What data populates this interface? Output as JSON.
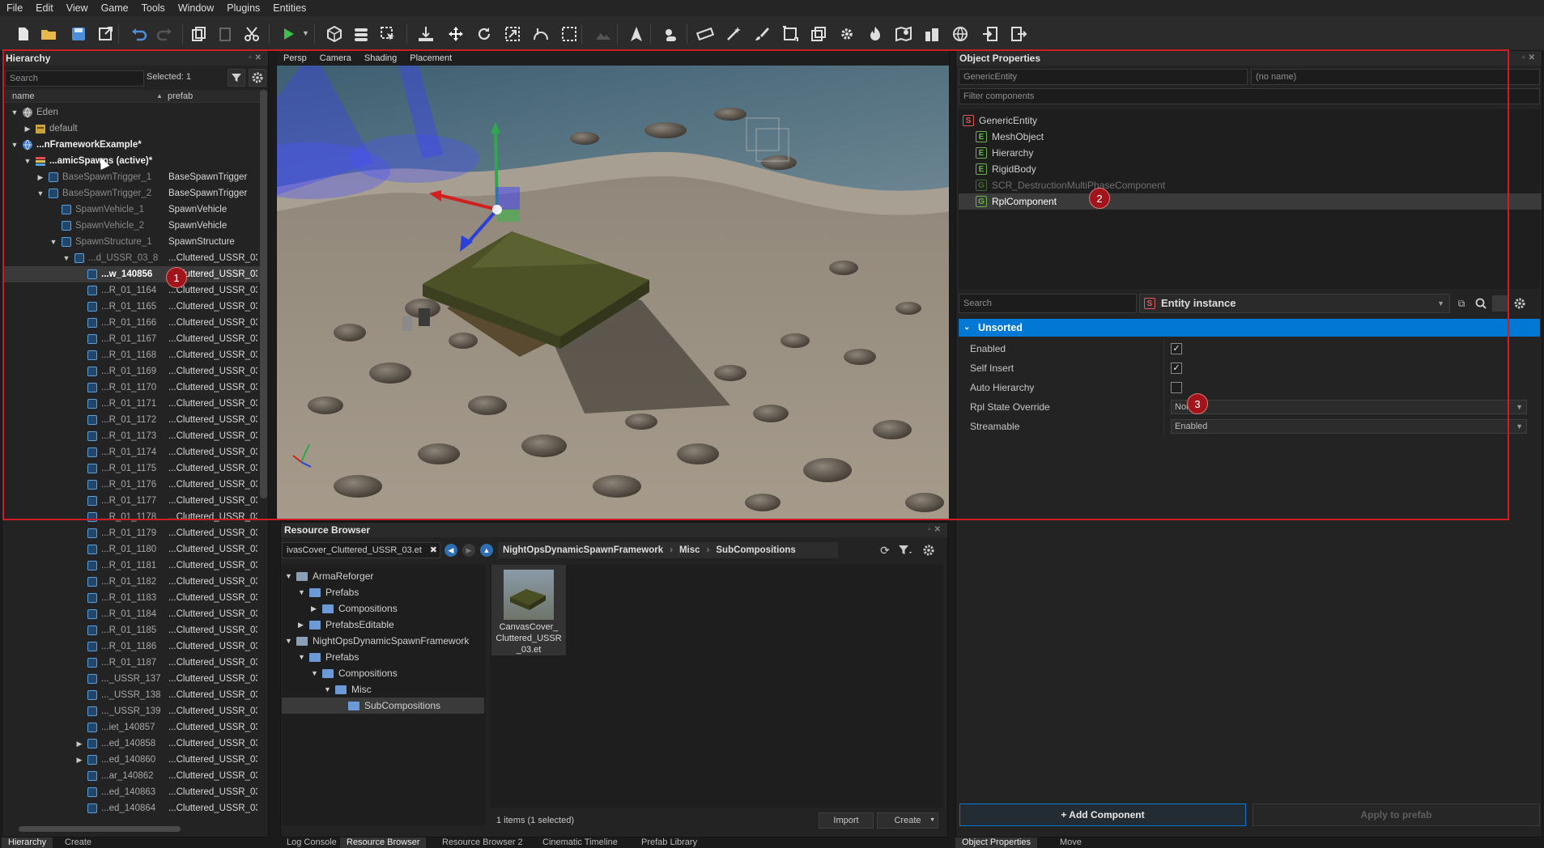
{
  "menu": [
    "File",
    "Edit",
    "View",
    "Game",
    "Tools",
    "Window",
    "Plugins",
    "Entities"
  ],
  "hierarchy": {
    "title": "Hierarchy",
    "search_placeholder": "Search",
    "selected": "Selected: 1",
    "col_name": "name",
    "col_prefab": "prefab",
    "rows": [
      {
        "name": "Eden",
        "prefab": ""
      },
      {
        "name": "default",
        "prefab": ""
      },
      {
        "name": "...nFrameworkExample*",
        "prefab": ""
      },
      {
        "name": "...amicSpawns (active)*",
        "prefab": ""
      },
      {
        "name": "BaseSpawnTrigger_1",
        "prefab": "BaseSpawnTrigger"
      },
      {
        "name": "BaseSpawnTrigger_2",
        "prefab": "BaseSpawnTrigger"
      },
      {
        "name": "SpawnVehicle_1",
        "prefab": "SpawnVehicle"
      },
      {
        "name": "SpawnVehicle_2",
        "prefab": "SpawnVehicle"
      },
      {
        "name": "SpawnStructure_1",
        "prefab": "SpawnStructure"
      },
      {
        "name": "...d_USSR_03_8",
        "prefab": "...Cluttered_USSR_03"
      },
      {
        "name": "...w_140856",
        "prefab": "...Cluttered_USSR_03"
      },
      {
        "name": "...R_01_1164",
        "prefab": "...Cluttered_USSR_03"
      },
      {
        "name": "...R_01_1165",
        "prefab": "...Cluttered_USSR_03"
      },
      {
        "name": "...R_01_1166",
        "prefab": "...Cluttered_USSR_03"
      },
      {
        "name": "...R_01_1167",
        "prefab": "...Cluttered_USSR_03"
      },
      {
        "name": "...R_01_1168",
        "prefab": "...Cluttered_USSR_03"
      },
      {
        "name": "...R_01_1169",
        "prefab": "...Cluttered_USSR_03"
      },
      {
        "name": "...R_01_1170",
        "prefab": "...Cluttered_USSR_03"
      },
      {
        "name": "...R_01_1171",
        "prefab": "...Cluttered_USSR_03"
      },
      {
        "name": "...R_01_1172",
        "prefab": "...Cluttered_USSR_03"
      },
      {
        "name": "...R_01_1173",
        "prefab": "...Cluttered_USSR_03"
      },
      {
        "name": "...R_01_1174",
        "prefab": "...Cluttered_USSR_03"
      },
      {
        "name": "...R_01_1175",
        "prefab": "...Cluttered_USSR_03"
      },
      {
        "name": "...R_01_1176",
        "prefab": "...Cluttered_USSR_03"
      },
      {
        "name": "...R_01_1177",
        "prefab": "...Cluttered_USSR_03"
      },
      {
        "name": "...R_01_1178",
        "prefab": "...Cluttered_USSR_03"
      },
      {
        "name": "...R_01_1179",
        "prefab": "...Cluttered_USSR_03"
      },
      {
        "name": "...R_01_1180",
        "prefab": "...Cluttered_USSR_03"
      },
      {
        "name": "...R_01_1181",
        "prefab": "...Cluttered_USSR_03"
      },
      {
        "name": "...R_01_1182",
        "prefab": "...Cluttered_USSR_03"
      },
      {
        "name": "...R_01_1183",
        "prefab": "...Cluttered_USSR_03"
      },
      {
        "name": "...R_01_1184",
        "prefab": "...Cluttered_USSR_03"
      },
      {
        "name": "...R_01_1185",
        "prefab": "...Cluttered_USSR_03"
      },
      {
        "name": "...R_01_1186",
        "prefab": "...Cluttered_USSR_03"
      },
      {
        "name": "...R_01_1187",
        "prefab": "...Cluttered_USSR_03"
      },
      {
        "name": "..._USSR_137",
        "prefab": "...Cluttered_USSR_03"
      },
      {
        "name": "..._USSR_138",
        "prefab": "...Cluttered_USSR_03"
      },
      {
        "name": "..._USSR_139",
        "prefab": "...Cluttered_USSR_03"
      },
      {
        "name": "...iet_140857",
        "prefab": "...Cluttered_USSR_03"
      },
      {
        "name": "...ed_140858",
        "prefab": "...Cluttered_USSR_03"
      },
      {
        "name": "...ed_140860",
        "prefab": "...Cluttered_USSR_03"
      },
      {
        "name": "...ar_140862",
        "prefab": "...Cluttered_USSR_03"
      },
      {
        "name": "...ed_140863",
        "prefab": "...Cluttered_USSR_03"
      },
      {
        "name": "...ed_140864",
        "prefab": "...Cluttered_USSR_03"
      }
    ]
  },
  "viewport": {
    "tabs": [
      "Persp",
      "Camera",
      "Shading",
      "Placement"
    ]
  },
  "object_properties": {
    "title": "Object Properties",
    "entity_class": "GenericEntity",
    "entity_name_placeholder": "(no name)",
    "filter_placeholder": "Filter components",
    "components": [
      {
        "badge": "S",
        "name": "GenericEntity"
      },
      {
        "badge": "E",
        "name": "MeshObject"
      },
      {
        "badge": "E",
        "name": "Hierarchy"
      },
      {
        "badge": "E",
        "name": "RigidBody"
      },
      {
        "badge": "G",
        "name": "SCR_DestructionMultiPhaseComponent"
      },
      {
        "badge": "G",
        "name": "RplComponent"
      }
    ],
    "search_placeholder": "Search",
    "instance_label": "Entity instance",
    "section": "Unsorted",
    "props": [
      {
        "label": "Enabled",
        "type": "check",
        "value": "✓"
      },
      {
        "label": "Self Insert",
        "type": "check",
        "value": "✓"
      },
      {
        "label": "Auto Hierarchy",
        "type": "check",
        "value": ""
      },
      {
        "label": "Rpl State Override",
        "type": "select",
        "value": "None"
      },
      {
        "label": "Streamable",
        "type": "select",
        "value": "Enabled"
      }
    ],
    "add_component": "+ Add Component",
    "apply_prefab": "Apply to prefab"
  },
  "resource_browser": {
    "title": "Resource Browser",
    "search_value": "ivasCover_Cluttered_USSR_03.et",
    "breadcrumb": [
      "NightOpsDynamicSpawnFramework",
      "Misc",
      "SubCompositions"
    ],
    "tree": [
      {
        "label": "ArmaReforger",
        "depth": 0,
        "arrow": "▼"
      },
      {
        "label": "Prefabs",
        "depth": 1,
        "arrow": "▼"
      },
      {
        "label": "Compositions",
        "depth": 2,
        "arrow": "▶"
      },
      {
        "label": "PrefabsEditable",
        "depth": 1,
        "arrow": "▶"
      },
      {
        "label": "NightOpsDynamicSpawnFramework",
        "depth": 0,
        "arrow": "▼"
      },
      {
        "label": "Prefabs",
        "depth": 1,
        "arrow": "▼"
      },
      {
        "label": "Compositions",
        "depth": 2,
        "arrow": "▼"
      },
      {
        "label": "Misc",
        "depth": 3,
        "arrow": "▼"
      },
      {
        "label": "SubCompositions",
        "depth": 4,
        "arrow": ""
      }
    ],
    "asset_name": "CanvasCover_\nCluttered_USSR\n_03.et",
    "status": "1 items (1 selected)",
    "import": "Import",
    "create": "Create"
  },
  "bottom_tabs": {
    "left": [
      "Hierarchy",
      "Create"
    ],
    "middle": [
      "Log Console",
      "Resource Browser",
      "Resource Browser 2",
      "Cinematic Timeline",
      "Prefab Library"
    ],
    "right": [
      "Object Properties",
      "Move"
    ]
  },
  "markers": [
    "1",
    "2",
    "3"
  ],
  "colors": {
    "accent": "#0078d4",
    "highlight": "#d01c24",
    "marker": "#a2141c"
  }
}
